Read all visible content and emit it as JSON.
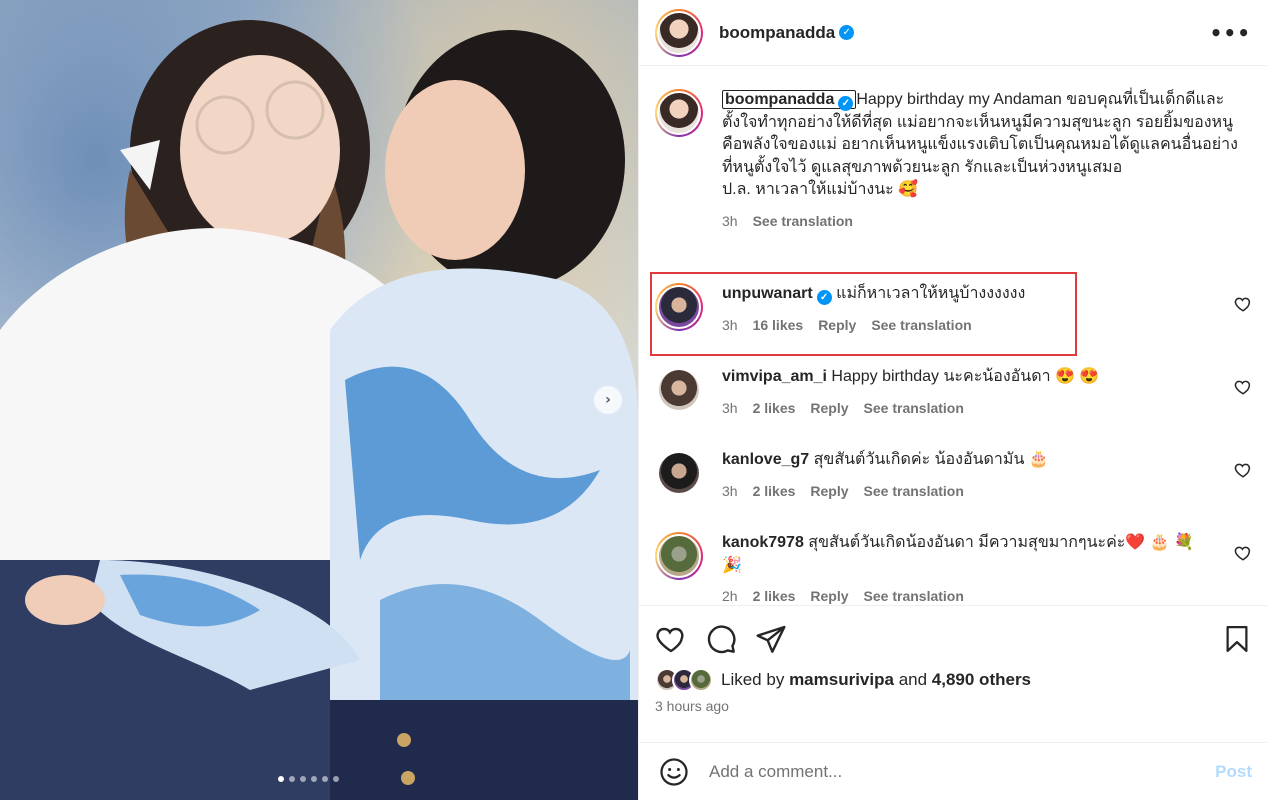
{
  "post": {
    "author": "boompanadda",
    "verified": true
  },
  "caption": {
    "username": "boompanadda",
    "text": "Happy birthday my Andaman ขอบคุณที่เป็นเด็กดีและตั้งใจทำทุกอย่างให้ดีที่สุด แม่อยากจะเห็นหนูมีความสุขนะลูก รอยยิ้มของหนูคือพลังใจของแม่ อยากเห็นหนูแข็งแรงเติบโตเป็นคุณหมอได้ดูแลคนอื่นอย่างที่หนูตั้งใจไว้ ดูแลสุขภาพด้วยนะลูก รักและเป็นห่วงหนูเสมอ",
    "ps": "ป.ล. หาเวลาให้แม่บ้างนะ 🥰",
    "time": "3h",
    "see_translation": "See translation"
  },
  "comments": [
    {
      "username": "unpuwanart",
      "verified": true,
      "text": "แม่ก็หาเวลาให้หนูบ้างงงงงง",
      "time": "3h",
      "likes": "16 likes",
      "reply": "Reply",
      "see_translation": "See translation"
    },
    {
      "username": "vimvipa_am_i",
      "verified": false,
      "text": "Happy birthday นะคะน้องอันดา 😍 😍",
      "time": "3h",
      "likes": "2 likes",
      "reply": "Reply",
      "see_translation": "See translation"
    },
    {
      "username": "kanlove_g7",
      "verified": false,
      "text": "สุขสันต์วันเกิดค่ะ น้องอันดามัน 🎂",
      "time": "3h",
      "likes": "2 likes",
      "reply": "Reply",
      "see_translation": "See translation"
    },
    {
      "username": "kanok7978",
      "verified": false,
      "text": "สุขสันต์วันเกิดน้องอันดา มีความสุขมากๆนะค่ะ❤️ 🎂 💐 🎉",
      "time": "2h",
      "likes": "2 likes",
      "reply": "Reply",
      "see_translation": "See translation"
    }
  ],
  "likes": {
    "prefix": "Liked by",
    "user": "mamsurivipa",
    "and": "and",
    "others": "4,890 others"
  },
  "time_ago": "3 hours ago",
  "add_comment": {
    "placeholder": "Add a comment...",
    "post_label": "Post"
  },
  "icons": {
    "verified": "verified-badge-icon",
    "more": "more-options-icon",
    "like": "heart-icon",
    "comment": "comment-icon",
    "share": "share-icon",
    "save": "bookmark-icon",
    "emoji": "emoji-icon",
    "next": "chevron-right-icon"
  },
  "colors": {
    "accent": "#0095f6",
    "highlight": "#e0393e",
    "post_disabled": "#b3dbff"
  },
  "carousel": {
    "count": 6,
    "active": 0
  },
  "glyphs": {
    "check": "✓",
    "more": "•••",
    "next": "›"
  }
}
